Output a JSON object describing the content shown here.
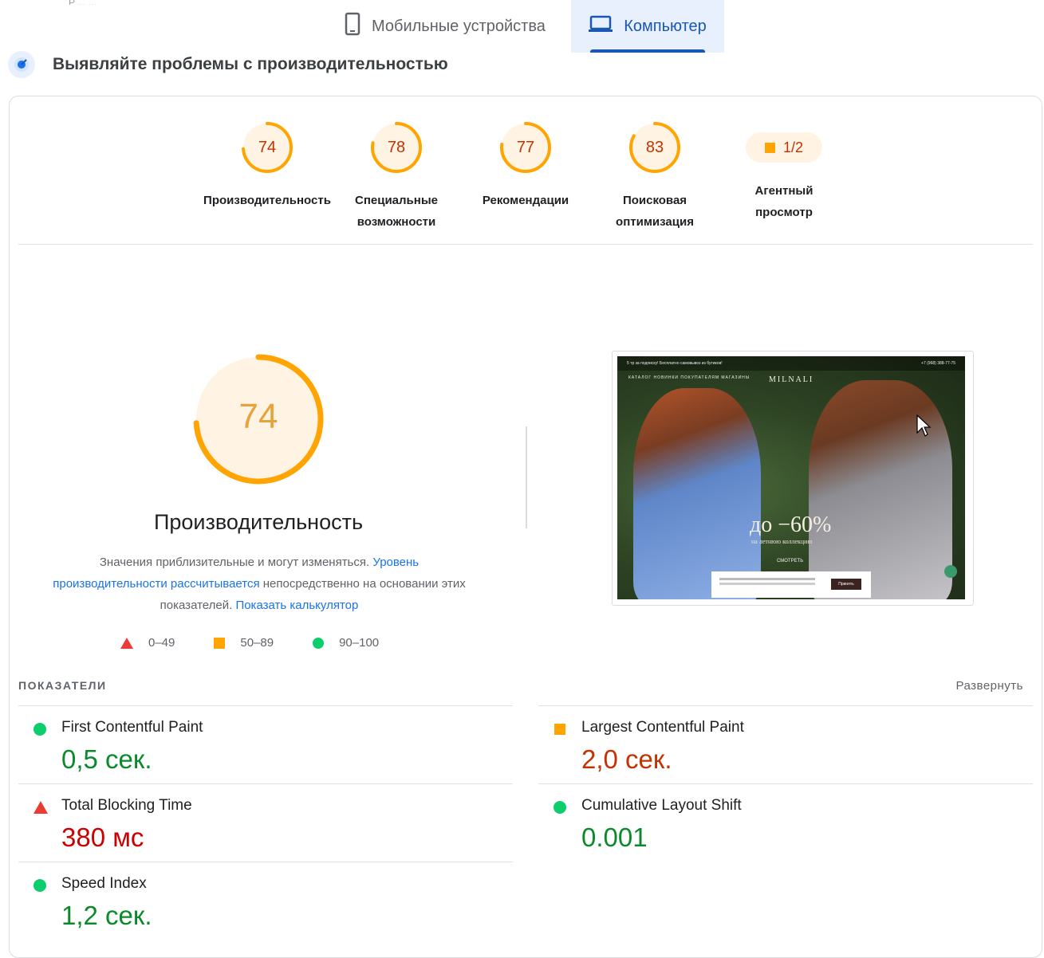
{
  "tabs": {
    "mobile": "Мобильные устройства",
    "desktop": "Компьютер"
  },
  "top_faint": "Р ... ...",
  "heading": "Выявляйте проблемы с производительностью",
  "scores": [
    {
      "value": "74",
      "fraction": 0.74,
      "label_line1": "Производительность",
      "label_line2": ""
    },
    {
      "value": "78",
      "fraction": 0.78,
      "label_line1": "Специальные",
      "label_line2": "возможности"
    },
    {
      "value": "77",
      "fraction": 0.77,
      "label_line1": "Рекомендации",
      "label_line2": ""
    },
    {
      "value": "83",
      "fraction": 0.83,
      "label_line1": "Поисковая",
      "label_line2": "оптимизация"
    },
    {
      "value": "1/2",
      "label_line1": "Агентный",
      "label_line2": "просмотр"
    }
  ],
  "main_score": {
    "value": "74",
    "fraction": 0.74,
    "title": "Производительность"
  },
  "description": {
    "text1": "Значения приблизительные и могут изменяться. ",
    "link1": "Уровень производительности рассчитывается",
    "text2": " непосредственно на основании этих показателей. ",
    "link2": "Показать калькулятор"
  },
  "legend": [
    {
      "range": "0–49",
      "shape": "triangle",
      "color": "#eb3b35"
    },
    {
      "range": "50–89",
      "shape": "square",
      "color": "#ffa400"
    },
    {
      "range": "90–100",
      "shape": "circle",
      "color": "#0cce6b"
    }
  ],
  "screenshot": {
    "topbar_left": "5 тр за подписку! Бесплатно самовывоз из бутиков!",
    "topbar_right": "+7 (968) 388-77-75",
    "nav": "КАТАЛОГ  НОВИНКИ  ПОКУПАТЕЛЯМ  МАГАЗИНЫ",
    "logo": "MILNALI",
    "promo": "до −60%",
    "promo_sub": "на летнюю коллекцию",
    "cta": "СМОТРЕТЬ",
    "cookie_button": "Принять"
  },
  "metrics": {
    "header": "ПОКАЗАТЕЛИ",
    "expand": "Развернуть",
    "fcp": {
      "name": "First Contentful Paint",
      "value": "0,5 сек.",
      "status": "good"
    },
    "lcp": {
      "name": "Largest Contentful Paint",
      "value": "2,0 сек.",
      "status": "average"
    },
    "tbt": {
      "name": "Total Blocking Time",
      "value": "380 мс",
      "status": "poor"
    },
    "cls": {
      "name": "Cumulative Layout Shift",
      "value": "0.001",
      "status": "good"
    },
    "si": {
      "name": "Speed Index",
      "value": "1,2 сек.",
      "status": "good"
    }
  },
  "colors": {
    "accent": "#1a56b4",
    "orange": "#ffa400",
    "good": "#0cce6b",
    "poor": "#eb3b35"
  }
}
